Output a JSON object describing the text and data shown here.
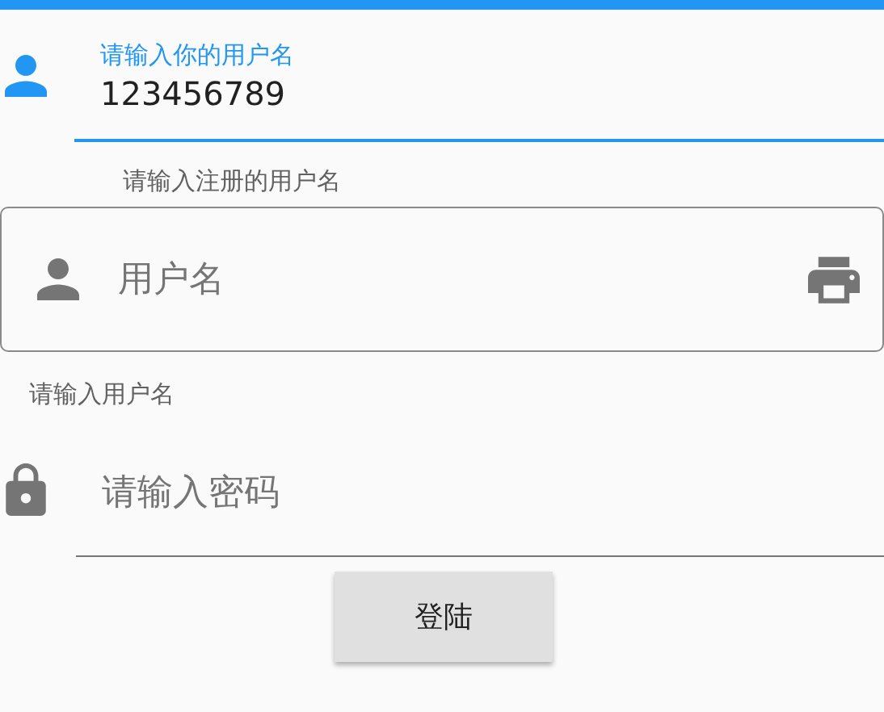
{
  "fields": [
    {
      "kind": "underline",
      "label": "请输入你的用户名",
      "value": "123456789",
      "helper": "请输入注册的用户名",
      "focused": true
    },
    {
      "kind": "outlined",
      "placeholder": "用户名",
      "helper": "请输入用户名",
      "focused": false
    },
    {
      "kind": "password",
      "placeholder": "请输入密码",
      "focused": false
    }
  ],
  "button": {
    "label": "登陆"
  }
}
